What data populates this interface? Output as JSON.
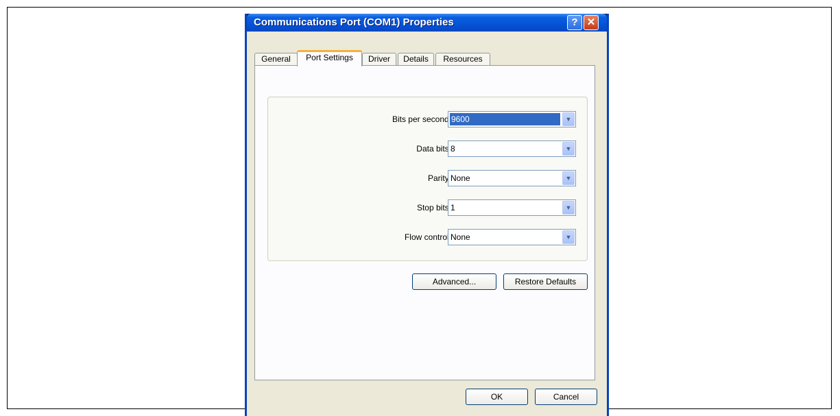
{
  "window": {
    "title": "Communications Port (COM1) Properties",
    "help_glyph": "?",
    "close_glyph": "✕"
  },
  "tabs": [
    {
      "label": "General"
    },
    {
      "label": "Port Settings"
    },
    {
      "label": "Driver"
    },
    {
      "label": "Details"
    },
    {
      "label": "Resources"
    }
  ],
  "settings": [
    {
      "label": "Bits per second:",
      "value": "9600"
    },
    {
      "label": "Data bits:",
      "value": "8"
    },
    {
      "label": "Parity:",
      "value": "None"
    },
    {
      "label": "Stop bits:",
      "value": "1"
    },
    {
      "label": "Flow control:",
      "value": "None"
    }
  ],
  "dropdown_arrow": "▼",
  "buttons": {
    "advanced": "Advanced...",
    "restore": "Restore Defaults",
    "ok": "OK",
    "cancel": "Cancel"
  },
  "colors": {
    "title_bar": "#0553d6",
    "selection": "#316ac5",
    "active_tab_accent": "#f5b13a",
    "dialog_face": "#ece9d8"
  }
}
